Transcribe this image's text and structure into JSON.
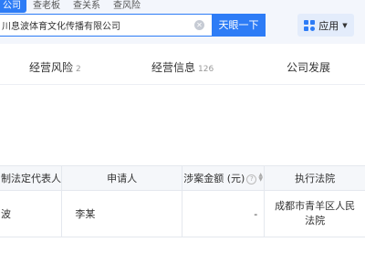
{
  "header": {
    "type_tabs": [
      {
        "label": "公司",
        "active": true
      },
      {
        "label": "查老板",
        "active": false
      },
      {
        "label": "查关系",
        "active": false
      },
      {
        "label": "查风险",
        "active": false
      }
    ],
    "search": {
      "value": "川息波体育文化传播有限公司",
      "button_label": "天眼一下"
    },
    "app_button_label": "应用"
  },
  "section_tabs": [
    {
      "label": "经营风险",
      "count": "2"
    },
    {
      "label": "经营信息",
      "count": "126"
    },
    {
      "label": "公司发展",
      "count": ""
    }
  ],
  "table": {
    "headers": [
      "制法定代表人",
      "申请人",
      "涉案金额 (元)",
      "执行法院"
    ],
    "rows": [
      {
        "legal_rep": "波",
        "applicant": "李某",
        "amount": "-",
        "court": [
          "成都市青羊区人民",
          "法院"
        ]
      }
    ]
  },
  "colors": {
    "accent": "#2d7cf6",
    "header_bg": "#f3f6fc"
  },
  "icons": {
    "clear": "clear-icon",
    "apps": "apps-grid-icon",
    "dropdown": "caret-down-icon",
    "help": "help-circle-icon",
    "sort": "sort-icon"
  }
}
